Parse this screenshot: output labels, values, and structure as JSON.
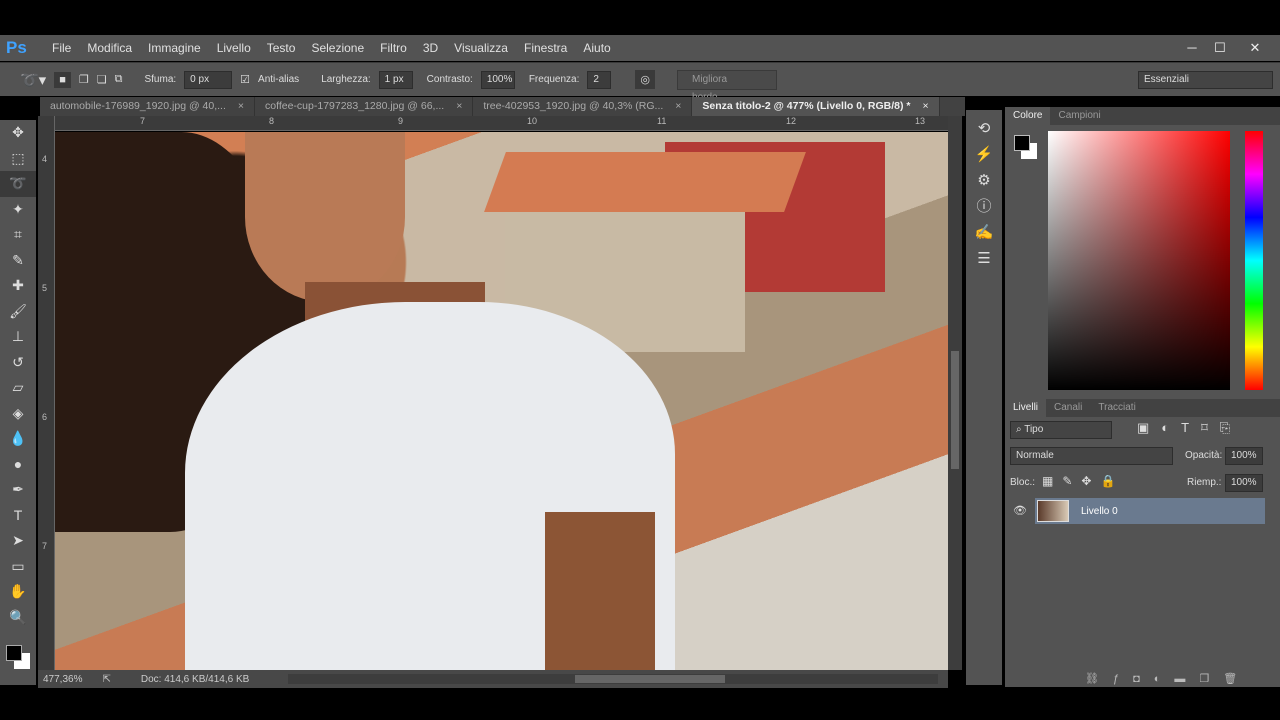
{
  "app": {
    "logo": "Ps",
    "menu": [
      "File",
      "Modifica",
      "Immagine",
      "Livello",
      "Testo",
      "Selezione",
      "Filtro",
      "3D",
      "Visualizza",
      "Finestra",
      "Aiuto"
    ],
    "window_controls": [
      "─",
      "☐",
      "✕"
    ]
  },
  "options": {
    "sfuma_label": "Sfuma:",
    "sfuma_value": "0 px",
    "antialias_label": "Anti-alias",
    "antialias_checked": true,
    "larghezza_label": "Larghezza:",
    "larghezza_value": "1 px",
    "contrasto_label": "Contrasto:",
    "contrasto_value": "100%",
    "frequenza_label": "Frequenza:",
    "frequenza_value": "2",
    "refine_button": "Migliora bordo...",
    "workspace": "Essenziali"
  },
  "tabs": [
    {
      "label": "automobile-176989_1920.jpg @ 40,..."
    },
    {
      "label": "coffee-cup-1797283_1280.jpg @ 66,..."
    },
    {
      "label": "tree-402953_1920.jpg @ 40,3% (RG..."
    },
    {
      "label": "Senza titolo-2 @ 477% (Livello 0, RGB/8) *",
      "active": true
    }
  ],
  "close_glyph": "×",
  "ruler": {
    "h": [
      "7",
      "8",
      "9",
      "10",
      "11",
      "12",
      "13"
    ],
    "v": [
      "4",
      "5",
      "6",
      "7"
    ]
  },
  "status": {
    "zoom": "477,36%",
    "doc": "Doc: 414,6 KB/414,6 KB"
  },
  "color_panel": {
    "tabs": [
      "Colore",
      "Campioni"
    ],
    "foreground": "#000000",
    "background": "#ffffff",
    "hue": "#ff0000"
  },
  "layers_panel": {
    "tabs": [
      "Livelli",
      "Canali",
      "Tracciati"
    ],
    "filter": "Tipo",
    "blend_mode": "Normale",
    "opacity_label": "Opacità:",
    "opacity": "100%",
    "lock_label": "Bloc.:",
    "fill_label": "Riemp.:",
    "fill": "100%",
    "layers": [
      {
        "name": "Livello 0",
        "visible": true
      }
    ]
  }
}
